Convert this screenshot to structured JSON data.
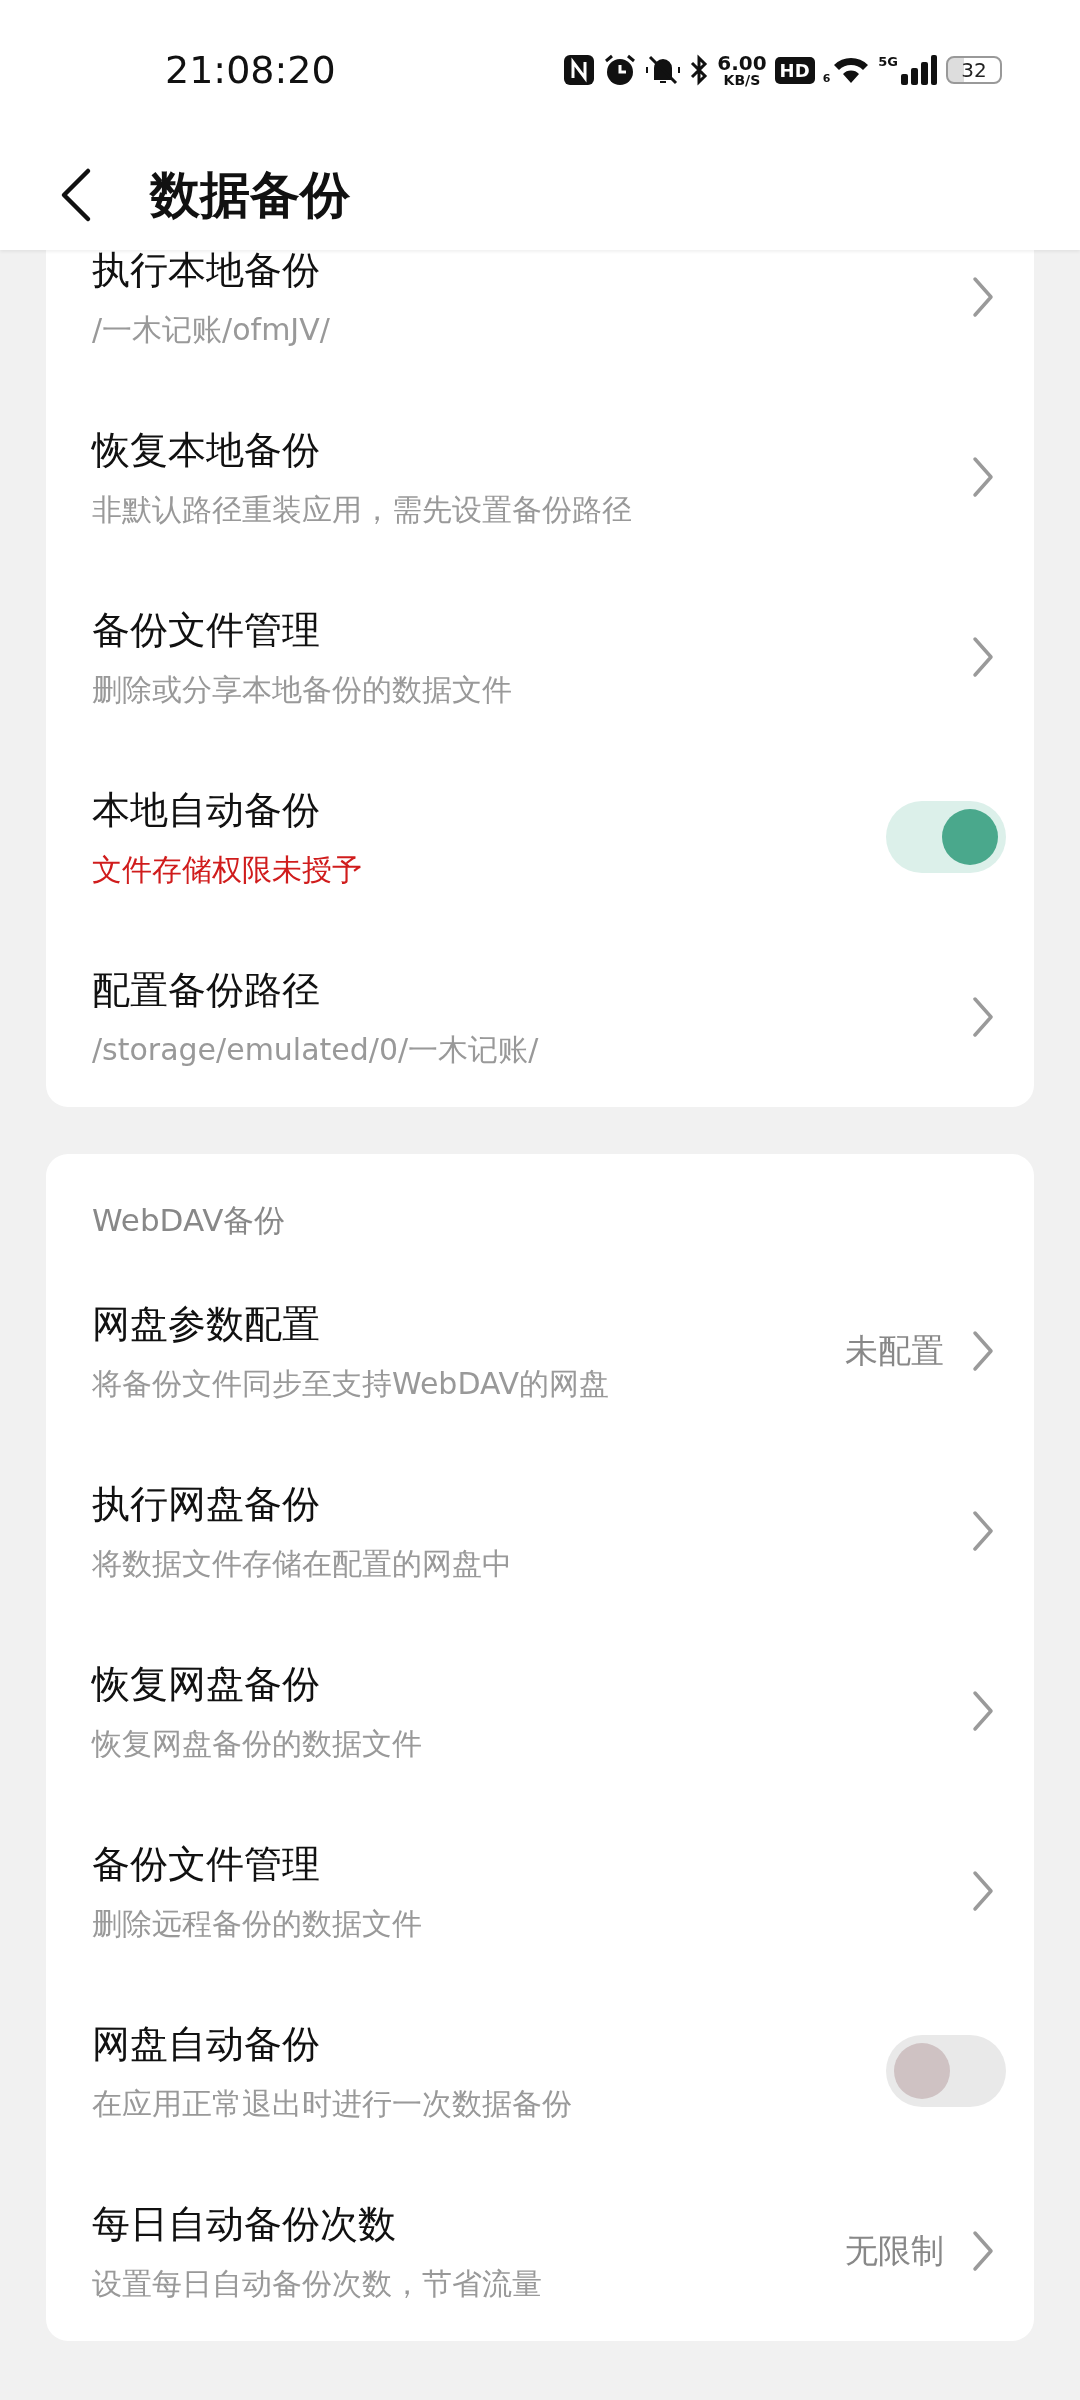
{
  "status_bar": {
    "time": "21:08:20",
    "speed_value": "6.00",
    "speed_unit": "KB/S",
    "hd": "HD",
    "network": "5G",
    "wifi_sub": "6",
    "battery": "32"
  },
  "header": {
    "title": "数据备份"
  },
  "sections": [
    {
      "rows": [
        {
          "kind": "link",
          "title": "执行本地备份",
          "subtitle": "/一木记账/ofmJV/",
          "warning": false
        },
        {
          "kind": "link",
          "title": "恢复本地备份",
          "subtitle": "非默认路径重装应用，需先设置备份路径",
          "warning": false
        },
        {
          "kind": "link",
          "title": "备份文件管理",
          "subtitle": "删除或分享本地备份的数据文件",
          "warning": false
        },
        {
          "kind": "toggle",
          "title": "本地自动备份",
          "subtitle": "文件存储权限未授予",
          "warning": true,
          "on": true
        },
        {
          "kind": "link",
          "title": "配置备份路径",
          "subtitle": "/storage/emulated/0/一木记账/",
          "warning": false
        }
      ]
    },
    {
      "title": "WebDAV备份",
      "rows": [
        {
          "kind": "link",
          "title": "网盘参数配置",
          "subtitle": "将备份文件同步至支持WebDAV的网盘",
          "warning": false,
          "value": "未配置"
        },
        {
          "kind": "link",
          "title": "执行网盘备份",
          "subtitle": "将数据文件存储在配置的网盘中",
          "warning": false
        },
        {
          "kind": "link",
          "title": "恢复网盘备份",
          "subtitle": "恢复网盘备份的数据文件",
          "warning": false
        },
        {
          "kind": "link",
          "title": "备份文件管理",
          "subtitle": "删除远程备份的数据文件",
          "warning": false
        },
        {
          "kind": "toggle",
          "title": "网盘自动备份",
          "subtitle": "在应用正常退出时进行一次数据备份",
          "warning": false,
          "on": false
        },
        {
          "kind": "link",
          "title": "每日自动备份次数",
          "subtitle": "设置每日自动备份次数，节省流量",
          "warning": false,
          "value": "无限制"
        }
      ]
    }
  ]
}
